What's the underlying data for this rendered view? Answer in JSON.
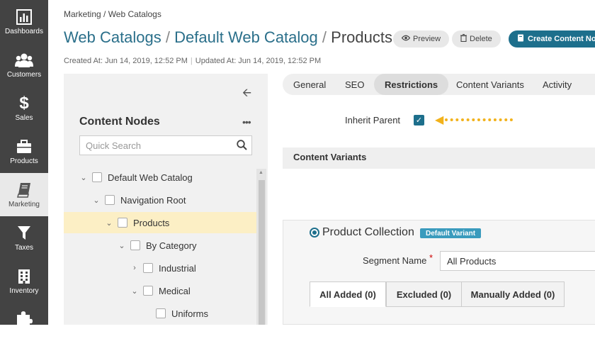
{
  "sidebar": {
    "items": [
      {
        "label": "Dashboards"
      },
      {
        "label": "Customers"
      },
      {
        "label": "Sales"
      },
      {
        "label": "Products"
      },
      {
        "label": "Marketing"
      },
      {
        "label": "Taxes"
      },
      {
        "label": "Inventory"
      }
    ],
    "active": "Marketing"
  },
  "breadcrumb": "Marketing / Web Catalogs",
  "title": {
    "part1": "Web Catalogs",
    "sep": "/",
    "part2": "Default Web Catalog",
    "part3": "Products"
  },
  "actions": {
    "preview": "Preview",
    "delete": "Delete",
    "create": "Create Content Node"
  },
  "meta": {
    "created": "Created At: Jun 14, 2019, 12:52 PM",
    "updated": "Updated At: Jun 14, 2019, 12:52 PM"
  },
  "tree": {
    "title": "Content Nodes",
    "search_placeholder": "Quick Search",
    "nodes": [
      {
        "label": "Default Web Catalog"
      },
      {
        "label": "Navigation Root"
      },
      {
        "label": "Products"
      },
      {
        "label": "By Category"
      },
      {
        "label": "Industrial"
      },
      {
        "label": "Medical"
      },
      {
        "label": "Uniforms"
      }
    ],
    "selected": "Products"
  },
  "tabs": [
    "General",
    "SEO",
    "Restrictions",
    "Content Variants",
    "Activity"
  ],
  "active_tab": "Restrictions",
  "inherit_parent": {
    "label": "Inherit Parent",
    "checked": true
  },
  "content_variants": {
    "section_title": "Content Variants"
  },
  "variant": {
    "title": "Product Collection",
    "badge": "Default Variant",
    "segment_label": "Segment Name",
    "segment_required_mark": "*",
    "segment_value": "All Products",
    "subtabs": [
      "All Added (0)",
      "Excluded (0)",
      "Manually Added (0)"
    ]
  },
  "colors": {
    "accent": "#1d6f8c",
    "sidebar": "#434343",
    "annotation_arrow": "#f2b21b",
    "selected_row": "#fcefc5"
  }
}
